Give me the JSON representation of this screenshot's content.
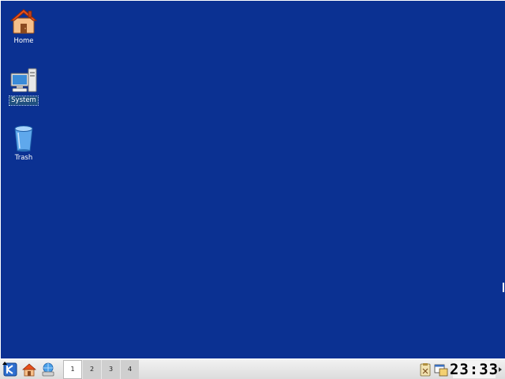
{
  "desktop": {
    "background_color": "#0b3192",
    "icons": [
      {
        "label": "Home",
        "icon": "home-folder-icon"
      },
      {
        "label": "System",
        "icon": "computer-icon",
        "selected": true
      },
      {
        "label": "Trash",
        "icon": "trash-icon"
      }
    ]
  },
  "taskbar": {
    "launchers": [
      {
        "icon": "kde-menu-icon"
      },
      {
        "icon": "home-icon"
      },
      {
        "icon": "network-icon"
      }
    ],
    "pager": {
      "desktops": [
        "1",
        "2",
        "3",
        "4"
      ],
      "active": "1"
    },
    "tray": {
      "icons": [
        "clipboard-icon",
        "window-list-icon"
      ]
    },
    "clock": "23:33"
  }
}
